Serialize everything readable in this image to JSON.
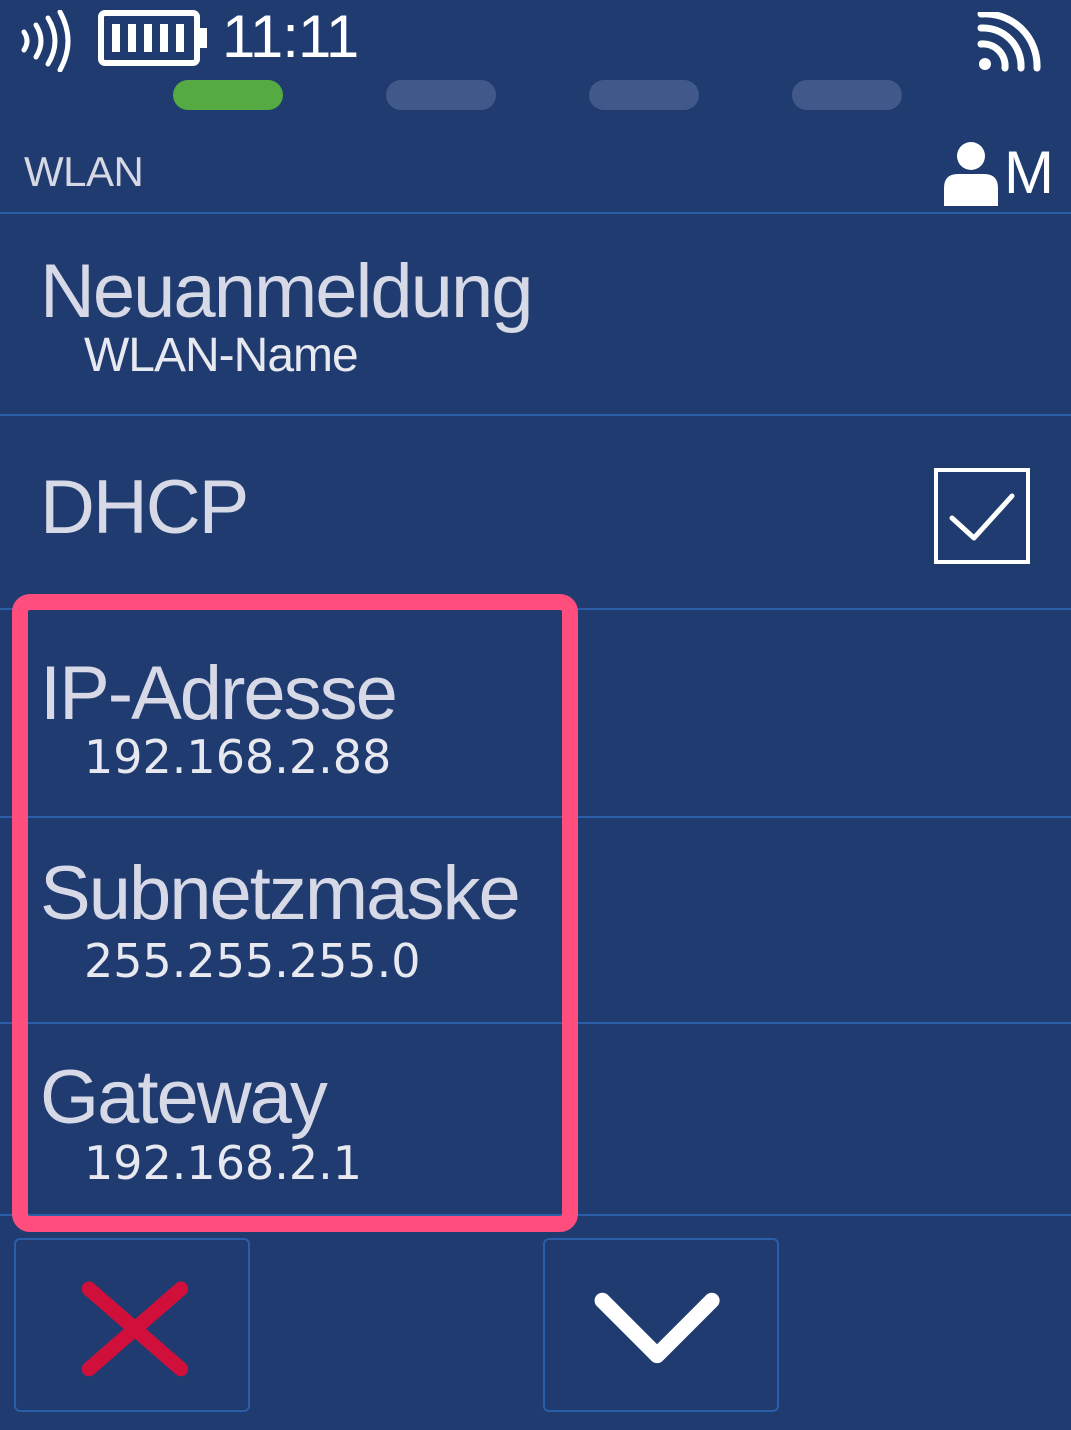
{
  "status_bar": {
    "time": "11:11",
    "icons": [
      "nfc-icon",
      "battery-icon",
      "wifi-signal-icon"
    ]
  },
  "pager": {
    "total_pages": 4,
    "active_page": 1,
    "active_color": "#55aa44"
  },
  "header": {
    "title": "WLAN",
    "user_mode": "M"
  },
  "rows": {
    "network": {
      "title": "Neuanmeldung",
      "value": "WLAN-Name"
    },
    "dhcp": {
      "title": "DHCP",
      "checked": true
    },
    "ip": {
      "title": "IP-Adresse",
      "value": "192.168.2.88"
    },
    "subnet": {
      "title": "Subnetzmaske",
      "value": "255.255.255.0"
    },
    "gateway": {
      "title": "Gateway",
      "value": "192.168.2.1"
    }
  },
  "buttons": {
    "cancel": {
      "icon": "close-icon",
      "color": "#d0103a"
    },
    "confirm": {
      "icon": "chevron-down-icon",
      "color": "#ffffff"
    }
  },
  "colors": {
    "background": "#1f3b70",
    "highlight": "#ff4d7e",
    "separator": "#2a5ea8"
  }
}
